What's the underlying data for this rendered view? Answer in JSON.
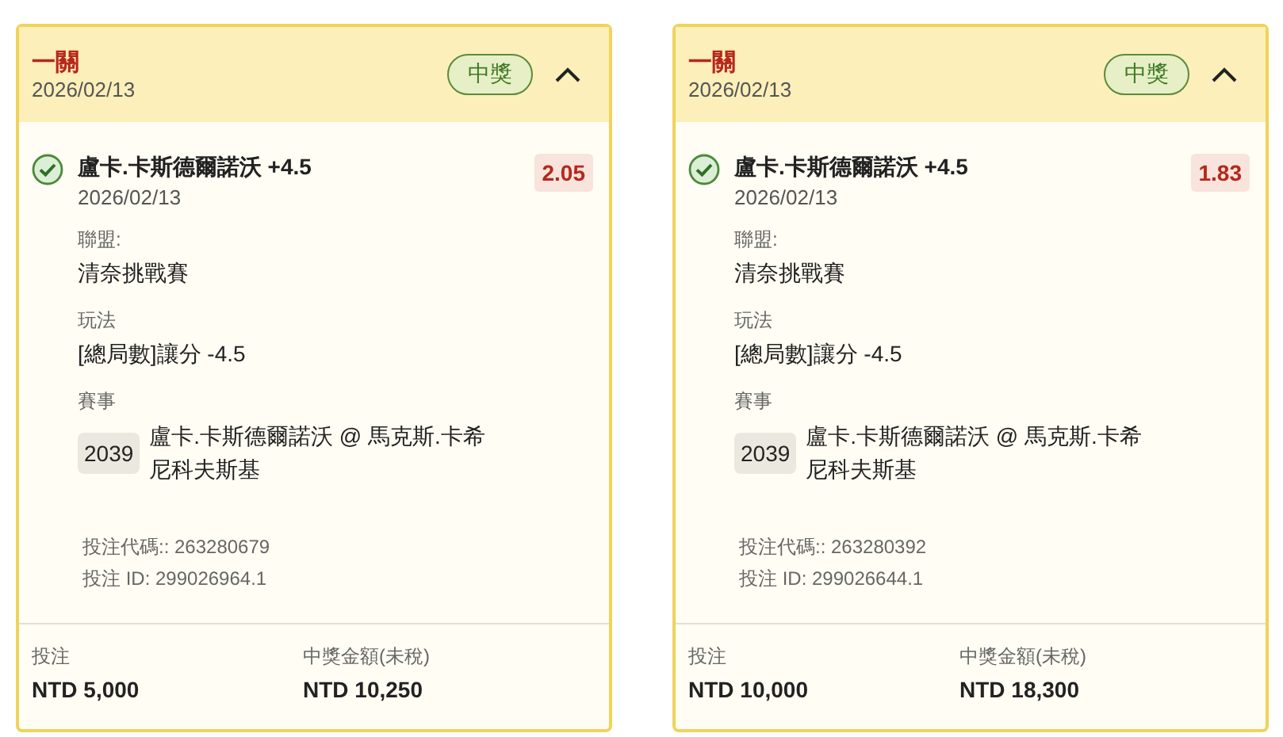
{
  "cards": [
    {
      "type": "一關",
      "date": "2026/02/13",
      "status": "中獎",
      "expanded": true,
      "selection": "盧卡.卡斯德爾諾沃 +4.5",
      "selection_date": "2026/02/13",
      "odds": "2.05",
      "league_label": "聯盟:",
      "league": "清奈挑戰賽",
      "market_label": "玩法",
      "market": "[總局數]讓分 -4.5",
      "event_label": "賽事",
      "event_no": "2039",
      "event": "盧卡.卡斯德爾諾沃 @ 馬克斯.卡希尼科夫斯基",
      "code": "投注代碼:: 263280679",
      "bet_id": "投注 ID: 299026964.1",
      "stake_label": "投注",
      "stake": "NTD 5,000",
      "payout_label": "中獎金額(未稅)",
      "payout": "NTD 10,250"
    },
    {
      "type": "一關",
      "date": "2026/02/13",
      "status": "中獎",
      "expanded": true,
      "selection": "盧卡.卡斯德爾諾沃 +4.5",
      "selection_date": "2026/02/13",
      "odds": "1.83",
      "league_label": "聯盟:",
      "league": "清奈挑戰賽",
      "market_label": "玩法",
      "market": "[總局數]讓分 -4.5",
      "event_label": "賽事",
      "event_no": "2039",
      "event": "盧卡.卡斯德爾諾沃 @ 馬克斯.卡希尼科夫斯基",
      "code": "投注代碼:: 263280392",
      "bet_id": "投注 ID: 299026644.1",
      "stake_label": "投注",
      "stake": "NTD 10,000",
      "payout_label": "中獎金額(未稅)",
      "payout": "NTD 18,300"
    }
  ]
}
